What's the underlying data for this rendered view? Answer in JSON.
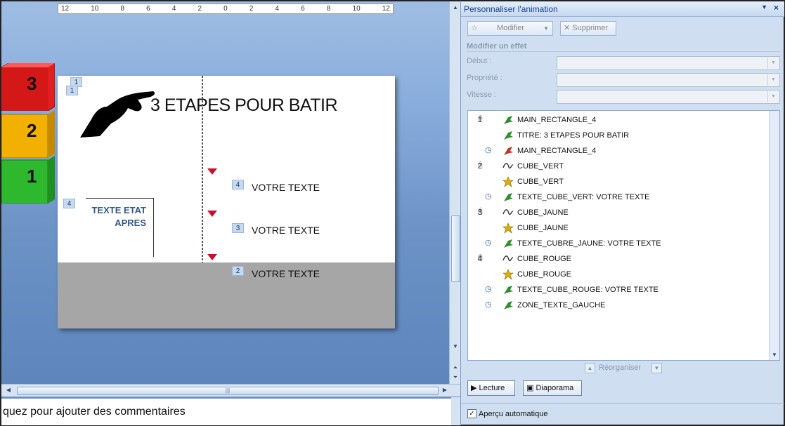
{
  "ruler": {
    "ticks": [
      "12",
      "10",
      "8",
      "6",
      "4",
      "2",
      "0",
      "2",
      "4",
      "6",
      "8",
      "10",
      "12"
    ]
  },
  "slide": {
    "title": "3 ETAPES POUR BATIR",
    "tags": {
      "title_top": "1",
      "title_bottom": "1",
      "state": "4",
      "step_4": "4",
      "step_3": "3",
      "step_2": "2"
    },
    "state_text_line1": "TEXTE ETAT",
    "state_text_line2": "APRES",
    "steps": [
      {
        "label": "VOTRE TEXTE"
      },
      {
        "label": "VOTRE TEXTE"
      },
      {
        "label": "VOTRE TEXTE"
      }
    ],
    "cubes": [
      {
        "number": "3",
        "color": "#e02020"
      },
      {
        "number": "2",
        "color": "#f2b000"
      },
      {
        "number": "1",
        "color": "#2eb82e"
      }
    ]
  },
  "notes": {
    "text": "quez pour ajouter des commentaires"
  },
  "pane": {
    "title": "Personnaliser l'animation",
    "menu_icon": "▼",
    "close_icon": "×",
    "modify_button": "Modifier",
    "delete_button": "Supprimer",
    "section_label": "Modifier un effet",
    "fields": {
      "start_label": "Début :",
      "property_label": "Propriété :",
      "speed_label": "Vitesse :"
    },
    "animations": [
      {
        "num": "1",
        "trigger": "mouse",
        "effect": "entrance",
        "label": "MAIN_RECTANGLE_4"
      },
      {
        "num": "",
        "trigger": "",
        "effect": "entrance",
        "label": "TITRE: 3 ETAPES POUR BATIR"
      },
      {
        "num": "",
        "trigger": "clock",
        "effect": "exit",
        "label": "MAIN_RECTANGLE_4"
      },
      {
        "num": "2",
        "trigger": "mouse",
        "effect": "path",
        "label": "CUBE_VERT"
      },
      {
        "num": "",
        "trigger": "",
        "effect": "emphasis",
        "label": "CUBE_VERT"
      },
      {
        "num": "",
        "trigger": "clock",
        "effect": "entrance",
        "label": "TEXTE_CUBE_VERT: VOTRE TEXTE"
      },
      {
        "num": "3",
        "trigger": "mouse",
        "effect": "path",
        "label": "CUBE_JAUNE"
      },
      {
        "num": "",
        "trigger": "",
        "effect": "emphasis",
        "label": "CUBE_JAUNE"
      },
      {
        "num": "",
        "trigger": "clock",
        "effect": "entrance",
        "label": "TEXTE_CUBRE_JAUNE: VOTRE TEXTE"
      },
      {
        "num": "4",
        "trigger": "mouse",
        "effect": "path",
        "label": "CUBE_ROUGE"
      },
      {
        "num": "",
        "trigger": "",
        "effect": "emphasis",
        "label": "CUBE_ROUGE"
      },
      {
        "num": "",
        "trigger": "clock",
        "effect": "entrance",
        "label": "TEXTE_CUBE_ROUGE: VOTRE TEXTE"
      },
      {
        "num": "",
        "trigger": "clock",
        "effect": "entrance",
        "label": "ZONE_TEXTE_GAUCHE"
      }
    ],
    "reorganize_label": "Réorganiser",
    "play_button": "Lecture",
    "slideshow_button": "Diaporama",
    "autopreview_label": "Aperçu automatique",
    "autopreview_checked": true
  }
}
